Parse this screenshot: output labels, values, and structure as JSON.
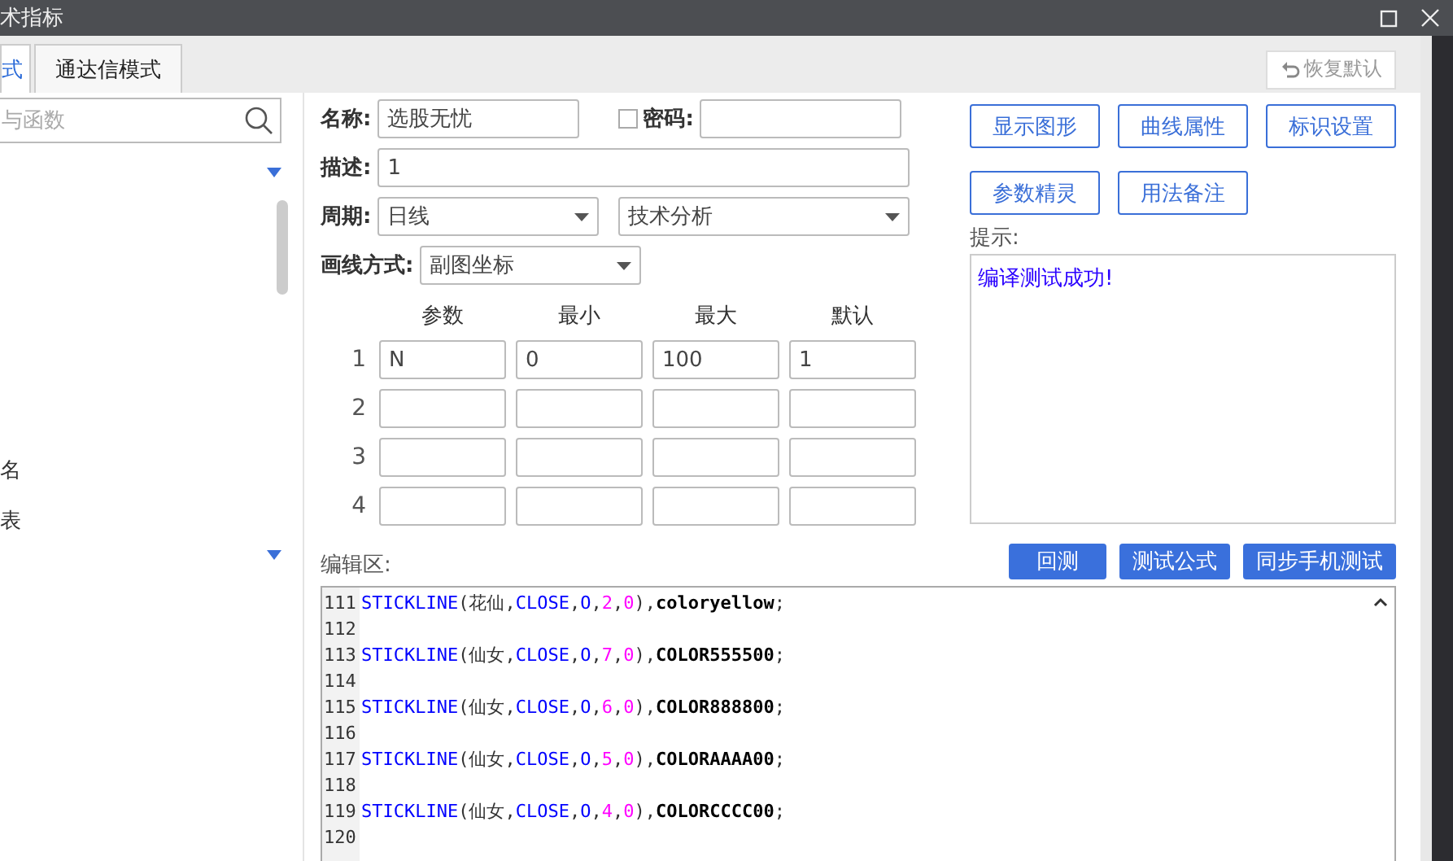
{
  "window": {
    "title": "术指标"
  },
  "restore_button": {
    "label": "恢复默认",
    "disabled": true
  },
  "tabs": [
    {
      "label": "式",
      "selected": true
    },
    {
      "label": "通达信模式",
      "selected": false
    }
  ],
  "sidebar": {
    "search": {
      "placeholder": "与函数"
    },
    "items": [
      "名",
      "表"
    ]
  },
  "form": {
    "name": {
      "label": "名称:",
      "value": "选股无忧"
    },
    "password": {
      "label": "密码:",
      "checked": false
    },
    "description": {
      "label": "描述:",
      "value": "1"
    },
    "period": {
      "label": "周期:",
      "value": "日线",
      "category": "技术分析"
    },
    "draw_mode": {
      "label": "画线方式:",
      "value": "副图坐标"
    }
  },
  "params": {
    "columns": [
      "参数",
      "最小",
      "最大",
      "默认"
    ],
    "rows": [
      {
        "index": "1",
        "values": [
          "N",
          "0",
          "100",
          "1"
        ]
      },
      {
        "index": "2",
        "values": []
      },
      {
        "index": "3",
        "values": []
      },
      {
        "index": "4",
        "values": []
      }
    ]
  },
  "action_buttons": [
    "显示图形",
    "曲线属性",
    "标识设置",
    "参数精灵",
    "用法备注"
  ],
  "hint": {
    "label": "提示:",
    "text": "编译测试成功!"
  },
  "editor": {
    "label": "编辑区:",
    "buttons": [
      "回测",
      "测试公式",
      "同步手机测试"
    ],
    "lines": [
      {
        "number": "111",
        "tokens": [
          {
            "kind": "function",
            "text": "STICKLINE"
          },
          {
            "kind": "plain",
            "text": "(花仙,"
          },
          {
            "kind": "variable",
            "text": "CLOSE"
          },
          {
            "kind": "plain",
            "text": ","
          },
          {
            "kind": "variable",
            "text": "O"
          },
          {
            "kind": "plain",
            "text": ","
          },
          {
            "kind": "number",
            "text": "2"
          },
          {
            "kind": "plain",
            "text": ","
          },
          {
            "kind": "number",
            "text": "0"
          },
          {
            "kind": "plain",
            "text": "),"
          },
          {
            "kind": "constant",
            "text": "coloryellow"
          },
          {
            "kind": "plain",
            "text": ";"
          }
        ]
      },
      {
        "number": "112"
      },
      {
        "number": "113",
        "tokens": [
          {
            "kind": "function",
            "text": "STICKLINE"
          },
          {
            "kind": "plain",
            "text": "(仙女,"
          },
          {
            "kind": "variable",
            "text": "CLOSE"
          },
          {
            "kind": "plain",
            "text": ","
          },
          {
            "kind": "variable",
            "text": "O"
          },
          {
            "kind": "plain",
            "text": ","
          },
          {
            "kind": "number",
            "text": "7"
          },
          {
            "kind": "plain",
            "text": ","
          },
          {
            "kind": "number",
            "text": "0"
          },
          {
            "kind": "plain",
            "text": "),"
          },
          {
            "kind": "constant",
            "text": "COLOR555500"
          },
          {
            "kind": "plain",
            "text": ";"
          }
        ]
      },
      {
        "number": "114"
      },
      {
        "number": "115",
        "tokens": [
          {
            "kind": "function",
            "text": "STICKLINE"
          },
          {
            "kind": "plain",
            "text": "(仙女,"
          },
          {
            "kind": "variable",
            "text": "CLOSE"
          },
          {
            "kind": "plain",
            "text": ","
          },
          {
            "kind": "variable",
            "text": "O"
          },
          {
            "kind": "plain",
            "text": ","
          },
          {
            "kind": "number",
            "text": "6"
          },
          {
            "kind": "plain",
            "text": ","
          },
          {
            "kind": "number",
            "text": "0"
          },
          {
            "kind": "plain",
            "text": "),"
          },
          {
            "kind": "constant",
            "text": "COLOR888800"
          },
          {
            "kind": "plain",
            "text": ";"
          }
        ]
      },
      {
        "number": "116"
      },
      {
        "number": "117",
        "tokens": [
          {
            "kind": "function",
            "text": "STICKLINE"
          },
          {
            "kind": "plain",
            "text": "(仙女,"
          },
          {
            "kind": "variable",
            "text": "CLOSE"
          },
          {
            "kind": "plain",
            "text": ","
          },
          {
            "kind": "variable",
            "text": "O"
          },
          {
            "kind": "plain",
            "text": ","
          },
          {
            "kind": "number",
            "text": "5"
          },
          {
            "kind": "plain",
            "text": ","
          },
          {
            "kind": "number",
            "text": "0"
          },
          {
            "kind": "plain",
            "text": "),"
          },
          {
            "kind": "constant",
            "text": "COLORAAAA00"
          },
          {
            "kind": "plain",
            "text": ";"
          }
        ]
      },
      {
        "number": "118"
      },
      {
        "number": "119",
        "tokens": [
          {
            "kind": "function",
            "text": "STICKLINE"
          },
          {
            "kind": "plain",
            "text": "(仙女,"
          },
          {
            "kind": "variable",
            "text": "CLOSE"
          },
          {
            "kind": "plain",
            "text": ","
          },
          {
            "kind": "variable",
            "text": "O"
          },
          {
            "kind": "plain",
            "text": ","
          },
          {
            "kind": "number",
            "text": "4"
          },
          {
            "kind": "plain",
            "text": ","
          },
          {
            "kind": "number",
            "text": "0"
          },
          {
            "kind": "plain",
            "text": "),"
          },
          {
            "kind": "constant",
            "text": "COLORCCCC00"
          },
          {
            "kind": "plain",
            "text": ";"
          }
        ]
      },
      {
        "number": "120"
      }
    ]
  }
}
